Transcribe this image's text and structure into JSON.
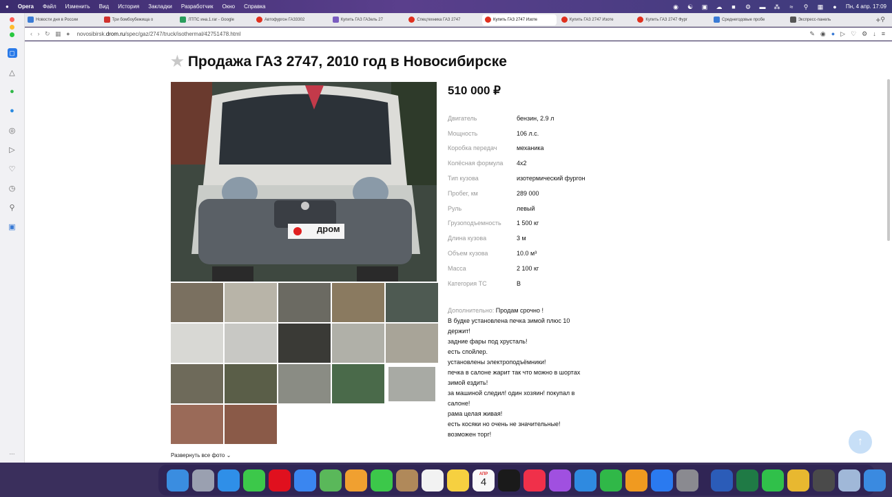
{
  "menubar": {
    "items": [
      "Opera",
      "Файл",
      "Изменить",
      "Вид",
      "История",
      "Закладки",
      "Разработчик",
      "Окно",
      "Справка"
    ],
    "clock": "Пн, 4 апр.  17:09"
  },
  "tabs": [
    {
      "label": "Новости дня в России",
      "color": "#3a7bd5"
    },
    {
      "label": "Три бомбоубежища о",
      "color": "#d0312d"
    },
    {
      "label": "ЛТПС ина.1.rar - Google",
      "color": "#2a9d5c"
    },
    {
      "label": "Автофургон ГАЗ3302",
      "color": "#e0301e"
    },
    {
      "label": "Купить ГАЗ ГАЗель 27",
      "color": "#7a5cc0"
    },
    {
      "label": "Спецтехника ГАЗ 2747",
      "color": "#e0301e"
    },
    {
      "label": "Купить ГАЗ 2747 Изоте",
      "color": "#e0301e",
      "active": true
    },
    {
      "label": "Купить ГАЗ 2747 Изоте",
      "color": "#e0301e"
    },
    {
      "label": "Купить ГАЗ 2747 Фург",
      "color": "#e0301e"
    },
    {
      "label": "Среднегодовые пробе",
      "color": "#3a7bd5"
    },
    {
      "label": "Экспресс-панель",
      "color": "#555555"
    }
  ],
  "address": {
    "domain_prefix": "novosibirsk.",
    "domain": "drom.ru",
    "path": "/spec/gaz/2747/truck/isothermal/42751478.html"
  },
  "listing": {
    "title": "Продажа ГАЗ 2747, 2010 год в Новосибирске",
    "price": "510 000 ₽",
    "watermark": "дром",
    "specs": [
      {
        "label": "Двигатель",
        "value": "бензин, 2.9 л"
      },
      {
        "label": "Мощность",
        "value": "106 л.с."
      },
      {
        "label": "Коробка передач",
        "value": "механика"
      },
      {
        "label": "Колёсная формула",
        "value": "4x2"
      },
      {
        "label": "Тип кузова",
        "value": "изотермический фургон"
      },
      {
        "label": "Пробег, км",
        "value": "289 000"
      },
      {
        "label": "Руль",
        "value": "левый"
      },
      {
        "label": "Грузоподъемность",
        "value": "1 500 кг"
      },
      {
        "label": "Длина кузова",
        "value": "3 м"
      },
      {
        "label": "Объем кузова",
        "value": "10.0 м³"
      },
      {
        "label": "Масса",
        "value": "2 100 кг"
      },
      {
        "label": "Категория ТС",
        "value": "B"
      }
    ],
    "desc_label": "Дополнительно:",
    "desc_lines": [
      "Продам срочно !",
      "В будке установлена печка зимой плюс 10",
      "держит!",
      "задние фары под хрусталь!",
      "есть спойлер.",
      "установлены электроподъёмники!",
      "печка в салоне жарит так что можно в шортах",
      "зимой ездить!",
      "за машиной следил! один хозяин! покупал в",
      "салоне!",
      "рама целая живая!",
      "есть косяки но очень не значительные!",
      "возможен торг!"
    ],
    "expand_photos": "Развернуть все фото",
    "thumbs": [
      "#7a7060",
      "#b8b4a8",
      "#6b6a62",
      "#8a7a60",
      "#4e5a52",
      "#d8d8d4",
      "#c8c8c4",
      "#3a3a36",
      "#b0b0a8",
      "#a8a498",
      "#6e6a5a",
      "#5a5e48",
      "#8a8c84",
      "#4a6a4a",
      "#a8aaa4",
      "#9a6a58",
      "#8a5a48"
    ]
  },
  "dock": {
    "calendar_month": "АПР",
    "calendar_day": "4",
    "icons": [
      {
        "name": "finder-icon",
        "color": "#3a8de0"
      },
      {
        "name": "launchpad-icon",
        "color": "#9aa0b0"
      },
      {
        "name": "safari-icon",
        "color": "#2f8fe8"
      },
      {
        "name": "messages-icon",
        "color": "#3cc84a"
      },
      {
        "name": "opera-icon",
        "color": "#e0101e"
      },
      {
        "name": "mail-icon",
        "color": "#3a86f0"
      },
      {
        "name": "maps-icon",
        "color": "#5ab85a"
      },
      {
        "name": "photos-icon",
        "color": "#f0a030"
      },
      {
        "name": "facetime-icon",
        "color": "#3cc84a"
      },
      {
        "name": "contacts-icon",
        "color": "#b0895a"
      },
      {
        "name": "reminders-icon",
        "color": "#f2f2f2"
      },
      {
        "name": "notes-icon",
        "color": "#f6d040"
      },
      {
        "name": "calendar-icon",
        "color": "#f8f8f8"
      },
      {
        "name": "tv-icon",
        "color": "#1a1a1a"
      },
      {
        "name": "music-icon",
        "color": "#f0304a"
      },
      {
        "name": "podcasts-icon",
        "color": "#a050e0"
      },
      {
        "name": "keynote-icon",
        "color": "#2f8ae0"
      },
      {
        "name": "numbers-icon",
        "color": "#30b848"
      },
      {
        "name": "pages-icon",
        "color": "#f09a20"
      },
      {
        "name": "appstore-icon",
        "color": "#2a7af0"
      },
      {
        "name": "system-preferences-icon",
        "color": "#8a8a90"
      },
      {
        "name": "word-icon",
        "color": "#2b5cb8"
      },
      {
        "name": "excel-icon",
        "color": "#1f7a45"
      },
      {
        "name": "whatsapp-icon",
        "color": "#30c04a"
      },
      {
        "name": "chrome-icon",
        "color": "#e8b830"
      },
      {
        "name": "tor-icon",
        "color": "#4a4a4a"
      },
      {
        "name": "finder-window-icon",
        "color": "#a0b8d8"
      },
      {
        "name": "preview-icon",
        "color": "#3a8ae0"
      },
      {
        "name": "trash-icon",
        "color": "#d8d8dc"
      }
    ]
  }
}
